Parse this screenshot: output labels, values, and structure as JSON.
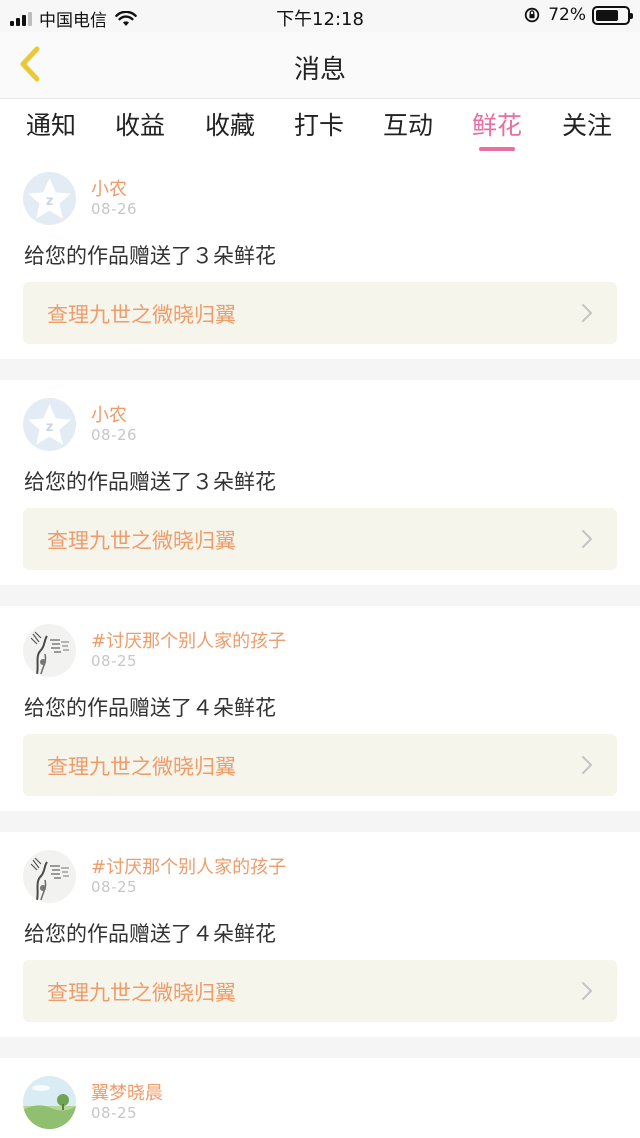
{
  "status_bar": {
    "carrier": "中国电信",
    "time": "下午12:18",
    "battery_percent": "72%",
    "battery_level": 0.72
  },
  "nav": {
    "title": "消息",
    "back_icon": "chevron-left-icon",
    "accent_color": "#e8c93a"
  },
  "tabs": [
    {
      "label": "通知",
      "active": false
    },
    {
      "label": "收益",
      "active": false
    },
    {
      "label": "收藏",
      "active": false
    },
    {
      "label": "打卡",
      "active": false
    },
    {
      "label": "互动",
      "active": false
    },
    {
      "label": "鲜花",
      "active": true
    },
    {
      "label": "关注",
      "active": false
    }
  ],
  "colors": {
    "active_tab": "#e86fa4",
    "sender_name": "#ee9c6a",
    "work_bg": "#f6f5ec"
  },
  "messages": [
    {
      "sender": "小农",
      "date": "08-26",
      "text": "给您的作品赠送了３朵鲜花",
      "work": "查理九世之微晓归翼",
      "avatar": "default-avatar"
    },
    {
      "sender": "小农",
      "date": "08-26",
      "text": "给您的作品赠送了３朵鲜花",
      "work": "查理九世之微晓归翼",
      "avatar": "default-avatar"
    },
    {
      "sender": "#讨厌那个别人家的孩子",
      "date": "08-25",
      "text": "给您的作品赠送了４朵鲜花",
      "work": "查理九世之微晓归翼",
      "avatar": "sketch-avatar"
    },
    {
      "sender": "#讨厌那个别人家的孩子",
      "date": "08-25",
      "text": "给您的作品赠送了４朵鲜花",
      "work": "查理九世之微晓归翼",
      "avatar": "sketch-avatar"
    },
    {
      "sender": "翼梦晓晨",
      "date": "08-25",
      "avatar": "landscape-avatar"
    }
  ]
}
